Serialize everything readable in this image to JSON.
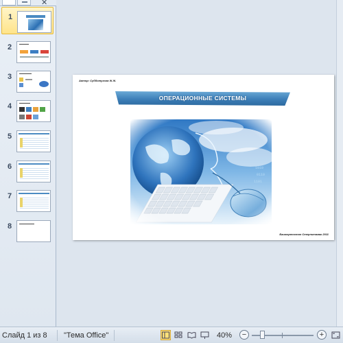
{
  "slides": [
    {
      "number": "1",
      "selected": true
    },
    {
      "number": "2"
    },
    {
      "number": "3"
    },
    {
      "number": "4"
    },
    {
      "number": "5"
    },
    {
      "number": "6"
    },
    {
      "number": "7"
    },
    {
      "number": "8"
    }
  ],
  "current_slide": {
    "author": "Автор: Субботухова Ж.Ж.",
    "title": "ОПЕРАЦИОННЫЕ СИСТЕМЫ",
    "footer": "Башкортостан Стерлитамак 2011",
    "image": "globe-keyboard-mouse-illustration"
  },
  "statusbar": {
    "slide_counter": "Слайд 1 из 8",
    "theme": "\"Тема Office\"",
    "zoom": "40%",
    "zoom_out": "−",
    "zoom_in": "+"
  },
  "colors": {
    "accent": "#3d7fb8",
    "selection": "#ffe48a",
    "background": "#dde5ee"
  }
}
